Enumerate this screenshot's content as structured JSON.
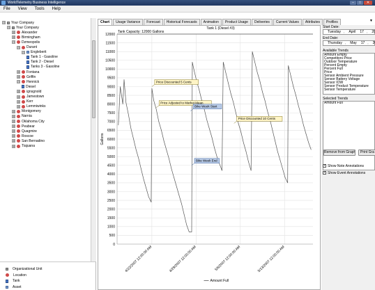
{
  "window": {
    "title": "WorldTelemetry Business Intelligence",
    "controls": {
      "minimize": "–",
      "maximize": "□",
      "close": "✕"
    }
  },
  "menu": [
    "File",
    "View",
    "Tools",
    "Help"
  ],
  "tree": [
    {
      "label": "Your Company",
      "icon": "company-icon",
      "expander": "⊟",
      "depth": 0
    },
    {
      "label": "Your Company",
      "icon": "company-icon",
      "expander": "⊟",
      "depth": 1
    },
    {
      "label": "Alexander",
      "icon": "location-icon",
      "expander": "⊞",
      "depth": 2
    },
    {
      "label": "Birmingham",
      "icon": "location-icon",
      "expander": "⊞",
      "depth": 2
    },
    {
      "label": "Dzmeopolis",
      "icon": "location-icon",
      "expander": "⊟",
      "depth": 2
    },
    {
      "label": "Durant",
      "icon": "location-icon",
      "expander": "⊟",
      "depth": 3
    },
    {
      "label": "Engleberit",
      "icon": "site-icon",
      "expander": "⊟",
      "depth": 4
    },
    {
      "label": "Tank 1 - Gasoline",
      "icon": "tank-icon",
      "expander": "",
      "depth": 5
    },
    {
      "label": "Tank 2 - Diesel",
      "icon": "tank-icon",
      "expander": "",
      "depth": 5
    },
    {
      "label": "Tanks 3 - Gasoline",
      "icon": "tank-icon",
      "expander": "",
      "depth": 5
    },
    {
      "label": "Fontana",
      "icon": "location-icon",
      "expander": "⊞",
      "depth": 3
    },
    {
      "label": "Griffin",
      "icon": "location-icon",
      "expander": "⊞",
      "depth": 3
    },
    {
      "label": "Hennick",
      "icon": "location-icon",
      "expander": "⊟",
      "depth": 3
    },
    {
      "label": "Diesel",
      "icon": "tank-icon",
      "expander": "",
      "depth": 4
    },
    {
      "label": "ignsgnold",
      "icon": "location-icon",
      "expander": "⊞",
      "depth": 3
    },
    {
      "label": "Jamestown",
      "icon": "location-icon",
      "expander": "⊞",
      "depth": 3
    },
    {
      "label": "Kerr",
      "icon": "location-icon",
      "expander": "⊞",
      "depth": 3
    },
    {
      "label": "Lemmiwinks",
      "icon": "location-icon",
      "expander": "⊞",
      "depth": 3
    },
    {
      "label": "Montgomery",
      "icon": "location-icon",
      "expander": "⊞",
      "depth": 2
    },
    {
      "label": "Narnia",
      "icon": "location-icon",
      "expander": "⊞",
      "depth": 2
    },
    {
      "label": "Oklahoma City",
      "icon": "location-icon",
      "expander": "⊞",
      "depth": 2
    },
    {
      "label": "Peabear",
      "icon": "location-icon",
      "expander": "⊞",
      "depth": 2
    },
    {
      "label": "Quagmire",
      "icon": "location-icon",
      "expander": "⊞",
      "depth": 2
    },
    {
      "label": "Roscoe",
      "icon": "location-icon",
      "expander": "⊞",
      "depth": 2
    },
    {
      "label": "San Bernadino",
      "icon": "location-icon",
      "expander": "⊞",
      "depth": 2
    },
    {
      "label": "Tiajuana",
      "icon": "location-icon",
      "expander": "⊞",
      "depth": 2
    }
  ],
  "legend": [
    {
      "label": "Organizational Unit",
      "icon": "company-icon"
    },
    {
      "label": "Location",
      "icon": "location-icon"
    },
    {
      "label": "Tank",
      "icon": "tank-icon"
    },
    {
      "label": "Asset",
      "icon": "site-icon"
    }
  ],
  "tabs": [
    "Chart",
    "Usage Variance",
    "Forecast",
    "Historical Forecasts",
    "Animation",
    "Product Usage",
    "Deliveries",
    "Current Values",
    "Attributes",
    "Profiles"
  ],
  "active_tab": "Chart",
  "right_panel": {
    "start_label": "Start Date:",
    "start_date": {
      "weekday": "Tuesday",
      "month": "April",
      "day": "17",
      "year": "2007"
    },
    "end_label": "End Date:",
    "end_date": {
      "weekday": "Thursday",
      "month": "May",
      "day": "17",
      "year": "2007"
    },
    "available_label": "Available Trends",
    "available_trends": [
      "Amount Empty",
      "Competitors Price",
      "Outdoor Temperature",
      "Percent Empty",
      "Percent Full",
      "Price",
      "Sensor Ambient Pressure",
      "Sensor Battery Voltage",
      "Sensor IOW",
      "Sensor Product Temperature",
      "Sensor Temperature"
    ],
    "selected_label": "Selected Trends",
    "selected_trends": [
      "Amount Full"
    ],
    "remove_button": "Remove from Graph",
    "print_button": "Print Gra",
    "show_note": "Show Note Annotations",
    "show_event": "Show Event Annotations"
  },
  "chart_data": {
    "type": "line",
    "title": "Tank 1 (Diesel #3)",
    "subtitle": "Tank Capacity: 12000 Gallons",
    "ylabel": "Gallons",
    "xlabel": "",
    "ylim": [
      0,
      12000
    ],
    "yticks": [
      0,
      500,
      1000,
      1500,
      2000,
      2500,
      3000,
      3500,
      4000,
      4500,
      5000,
      5500,
      6000,
      6500,
      7000,
      7500,
      8000,
      8500,
      9000,
      9500,
      10000,
      10500,
      11000,
      11500,
      12000
    ],
    "xlim": [
      0,
      31
    ],
    "xticks": [
      {
        "x": 5.5,
        "label": "4/22/2007 12:00:00 AM"
      },
      {
        "x": 12.5,
        "label": "4/29/2007 12:00:00 AM"
      },
      {
        "x": 19.5,
        "label": "5/6/2007 12:00:00 AM"
      },
      {
        "x": 26.5,
        "label": "5/13/2007 12:00:00 AM"
      }
    ],
    "grid": true,
    "legend_position": "bottom",
    "series": [
      {
        "name": "Amount Full",
        "color": "#555555",
        "x": [
          0.2,
          0.5,
          0.9,
          1.1,
          1.4,
          1.8,
          2.2,
          2.6,
          3.0,
          3.4,
          3.8,
          4.2,
          4.6,
          5.0,
          5.4,
          5.5,
          5.8,
          6.2,
          6.6,
          7.0,
          7.4,
          7.8,
          8.2,
          8.6,
          9.0,
          9.4,
          9.8,
          10.2,
          10.6,
          11.0,
          11.4,
          11.8,
          11.9,
          12.2,
          12.6,
          13.0,
          13.4,
          13.8,
          14.2,
          14.6,
          15.0,
          15.4,
          15.8,
          16.2,
          16.6,
          16.8,
          17.2,
          17.6,
          18.0,
          18.4,
          18.8,
          19.2,
          19.6,
          20.0,
          20.4,
          20.8,
          21.2,
          21.4,
          21.8,
          22.2,
          22.6,
          23.0,
          23.4,
          23.8,
          24.2,
          24.6,
          25.0,
          25.4,
          25.8,
          26.2,
          26.6,
          27.0,
          27.1,
          27.5,
          27.9,
          28.3,
          28.7,
          29.1,
          29.5,
          29.9,
          30.3,
          30.7
        ],
        "y": [
          6800,
          9000,
          8000,
          9400,
          8100,
          7400,
          6600,
          6000,
          5400,
          4900,
          4300,
          3700,
          3200,
          2700,
          2400,
          8900,
          8200,
          7700,
          7000,
          6500,
          5900,
          5400,
          4900,
          4300,
          3800,
          3300,
          2800,
          2300,
          1700,
          1100,
          700,
          700,
          10400,
          9900,
          9300,
          8800,
          8200,
          7700,
          7100,
          6600,
          6100,
          5500,
          5000,
          4600,
          4200,
          10400,
          9800,
          9200,
          8600,
          8100,
          7500,
          6900,
          6400,
          5800,
          5300,
          4700,
          4200,
          11000,
          10400,
          9800,
          9300,
          8700,
          8200,
          7600,
          7100,
          6500,
          5900,
          5300,
          4800,
          4300,
          3800,
          3500,
          10200,
          9600,
          9000,
          8500,
          7900,
          7400,
          6800,
          6300,
          5800,
          5400
        ]
      }
    ],
    "annotations": [
      {
        "text": "Price Discounted 5 Cents",
        "x": 5.5,
        "y": 9000,
        "style": "note",
        "placement": "right-above"
      },
      {
        "text": "Price Adjusted to Market Mean",
        "x": 6.2,
        "y": 7800,
        "style": "note",
        "placement": "right-above"
      },
      {
        "text": "Bike Week Start",
        "x": 11.6,
        "y": 7600,
        "style": "event",
        "placement": "right-above"
      },
      {
        "text": "Price Discounted 10 Cents",
        "x": 18.5,
        "y": 6900,
        "style": "note",
        "placement": "right-above"
      },
      {
        "text": "Bike Week End",
        "x": 11.8,
        "y": 4500,
        "style": "event",
        "placement": "right-above"
      }
    ]
  }
}
